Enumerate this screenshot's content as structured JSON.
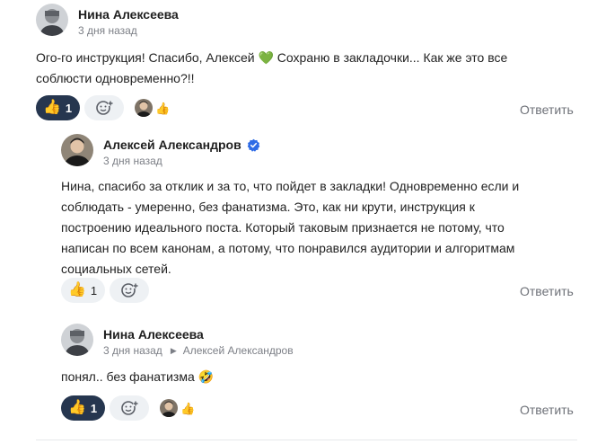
{
  "comments": [
    {
      "author": "Нина Алексеева",
      "time": "3 дня назад",
      "text": "Ого-го инструкция! Спасибо, Алексей 💚 Сохраню в закладочки... Как же это все\nсоблюсти одновременно?!!",
      "likes": "1",
      "like_active": true,
      "reply_label": "Ответить",
      "avatar_icon": "user-photo",
      "reaction_icon": "thumbs-up"
    },
    {
      "author": "Алексей Александров",
      "verified": true,
      "time": "3 дня назад",
      "text": "Нина, спасибо за отклик и за то, что пойдет в закладки! Одновременно если и\nсоблюдать - умеренно, без фанатизма. Это, как ни крути, инструкция к\nпостроению идеального поста. Который таковым признается не потому, что\nнаписан по всем канонам, а потому, что понравился аудитории и алгоритмам\nсоциальных сетей.",
      "likes": "1",
      "like_active": false,
      "reply_label": "Ответить",
      "avatar_icon": "user-photo"
    },
    {
      "author": "Нина Алексеева",
      "time": "3 дня назад",
      "reply_to": "Алексей Александров",
      "text": "понял.. без фанатизма 🤣",
      "likes": "1",
      "like_active": true,
      "reply_label": "Ответить",
      "avatar_icon": "user-photo"
    }
  ],
  "colors": {
    "like_active_bg": "#26364f",
    "chip_bg": "#eef1f4",
    "verified": "#2e6be6",
    "muted_text": "#7c7f86"
  }
}
